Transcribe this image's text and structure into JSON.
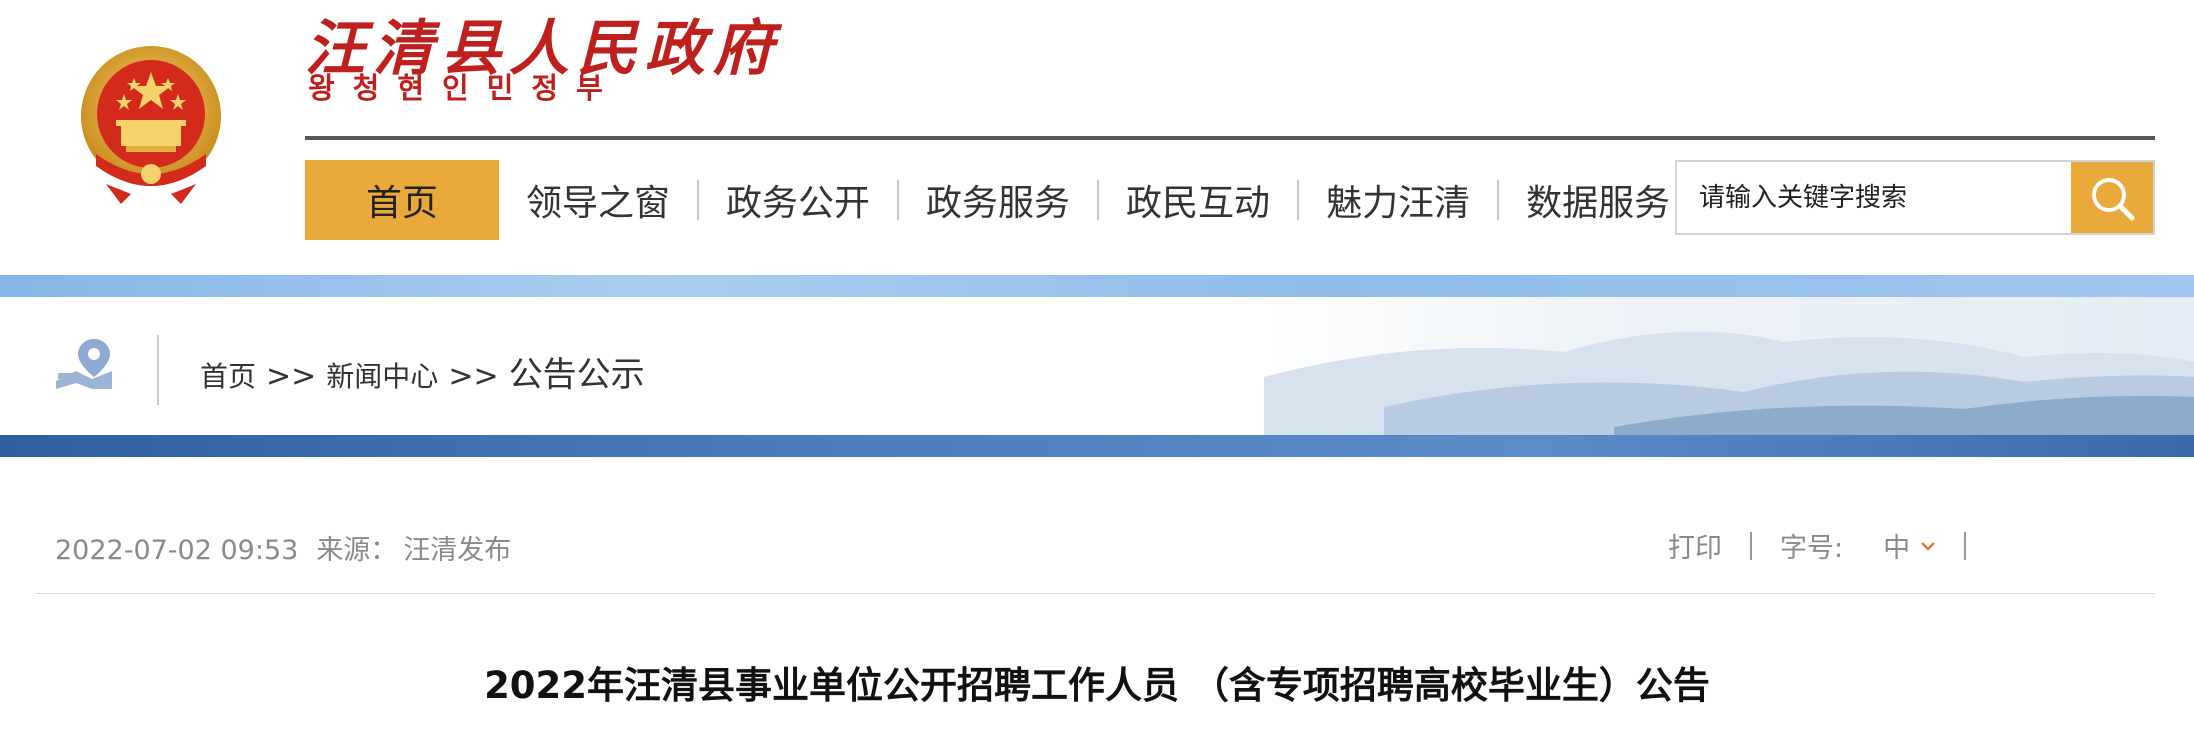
{
  "header": {
    "site_title": "汪清县人民政府",
    "site_subtitle": "왕청현인민정부",
    "emblem_icon": "national-emblem-icon"
  },
  "nav": {
    "items": [
      {
        "label": "首页",
        "active": true
      },
      {
        "label": "领导之窗",
        "active": false
      },
      {
        "label": "政务公开",
        "active": false
      },
      {
        "label": "政务服务",
        "active": false
      },
      {
        "label": "政民互动",
        "active": false
      },
      {
        "label": "魅力汪清",
        "active": false
      },
      {
        "label": "数据服务",
        "active": false
      }
    ],
    "active_color": "#e9a93b"
  },
  "search": {
    "placeholder": "请输入关键字搜索",
    "button_icon": "search-icon"
  },
  "breadcrumb": {
    "icon": "location-map-icon",
    "items": [
      "首页",
      "新闻中心",
      "公告公示"
    ],
    "separator": ">>"
  },
  "article_meta": {
    "datetime": "2022-07-02 09:53",
    "source_label": "来源：",
    "source_value": "汪清发布"
  },
  "tools": {
    "print_label": "打印",
    "font_size_label": "字号:",
    "font_size_value": "中",
    "dropdown_icon": "chevron-down-icon"
  },
  "article": {
    "title": "2022年汪清县事业单位公开招聘工作人员 （含专项招聘高校毕业生）公告"
  },
  "colors": {
    "brand_red": "#c0201d",
    "accent_orange": "#e9a93b",
    "banner_blue": "#4d7fbf"
  }
}
